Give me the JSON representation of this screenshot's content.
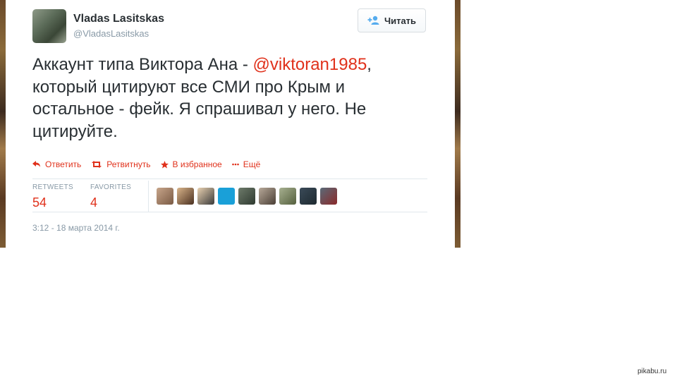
{
  "user": {
    "name": "Vladas Lasitskas",
    "handle": "@VladasLasitskas"
  },
  "follow": {
    "label": "Читать",
    "icon": "add-user-icon"
  },
  "tweet": {
    "text_before": "Аккаунт типа Виктора Ана - ",
    "mention": "@viktoran1985",
    "text_after": ", который цитируют все СМИ про Крым и остальное - фейк. Я спрашивал у него. Не цитируйте."
  },
  "actions": [
    {
      "label": "Ответить",
      "icon": "reply-icon"
    },
    {
      "label": "Ретвитнуть",
      "icon": "retweet-icon"
    },
    {
      "label": "В избранное",
      "icon": "star-icon"
    },
    {
      "label": "Ещё",
      "icon": "more-dots-icon"
    }
  ],
  "stats": {
    "retweets_label": "RETWEETS",
    "retweets_value": "54",
    "favorites_label": "FAVORITES",
    "favorites_value": "4"
  },
  "timestamp": "3:12 - 18 марта 2014 г.",
  "watermark": "pikabu.ru",
  "colors": {
    "accent": "#e0311b",
    "text": "#292f33",
    "muted": "#8899a6",
    "divider": "#e1e8ed"
  }
}
